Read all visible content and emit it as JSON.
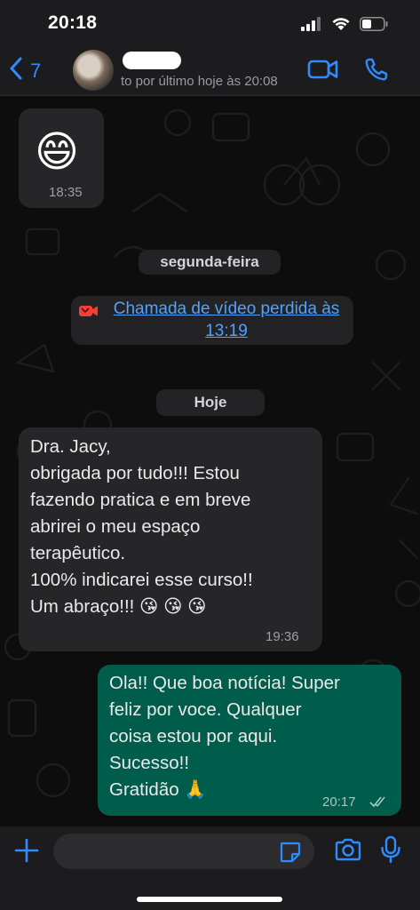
{
  "status_bar": {
    "time": "20:18",
    "signal_icon": "cellular-signal-icon",
    "wifi_icon": "wifi-icon",
    "battery_icon": "battery-icon"
  },
  "header": {
    "back_count": "7",
    "last_seen": "to por último hoje às 20:08",
    "video_call_icon": "video-camera-icon",
    "voice_call_icon": "phone-icon",
    "accent_color": "#2f8cff"
  },
  "messages": [
    {
      "direction": "in",
      "text": "😄",
      "time": "18:35"
    },
    {
      "direction": "in",
      "text": "Dra. Jacy,\nobrigada por tudo!!! Estou\nfazendo pratica e em breve\nabrirei o meu espaço\nterapêutico.\n100% indicarei esse curso!!\nUm abraço!!! 😘 😘 😘",
      "time": "19:36"
    },
    {
      "direction": "out",
      "text": "Ola!! Que boa notícia! Super\nfeliz por voce. Qualquer\ncoisa estou por aqui.\nSucesso!!\nGratidão 🙏",
      "time": "20:17",
      "status_icon": "double-check-icon"
    }
  ],
  "date_separators": {
    "monday": "segunda-feira",
    "today": "Hoje"
  },
  "missed_call": {
    "text": "Chamada de vídeo perdida às 13:19",
    "icon": "missed-video-call-icon"
  },
  "input_bar": {
    "add_icon": "plus-icon",
    "sticker_icon": "sticker-icon",
    "camera_icon": "camera-icon",
    "mic_icon": "microphone-icon"
  },
  "colors": {
    "incoming_bubble": "#262628",
    "outgoing_bubble": "#005c4b",
    "link": "#4fa3ff",
    "missed_red": "#ff3b30"
  }
}
